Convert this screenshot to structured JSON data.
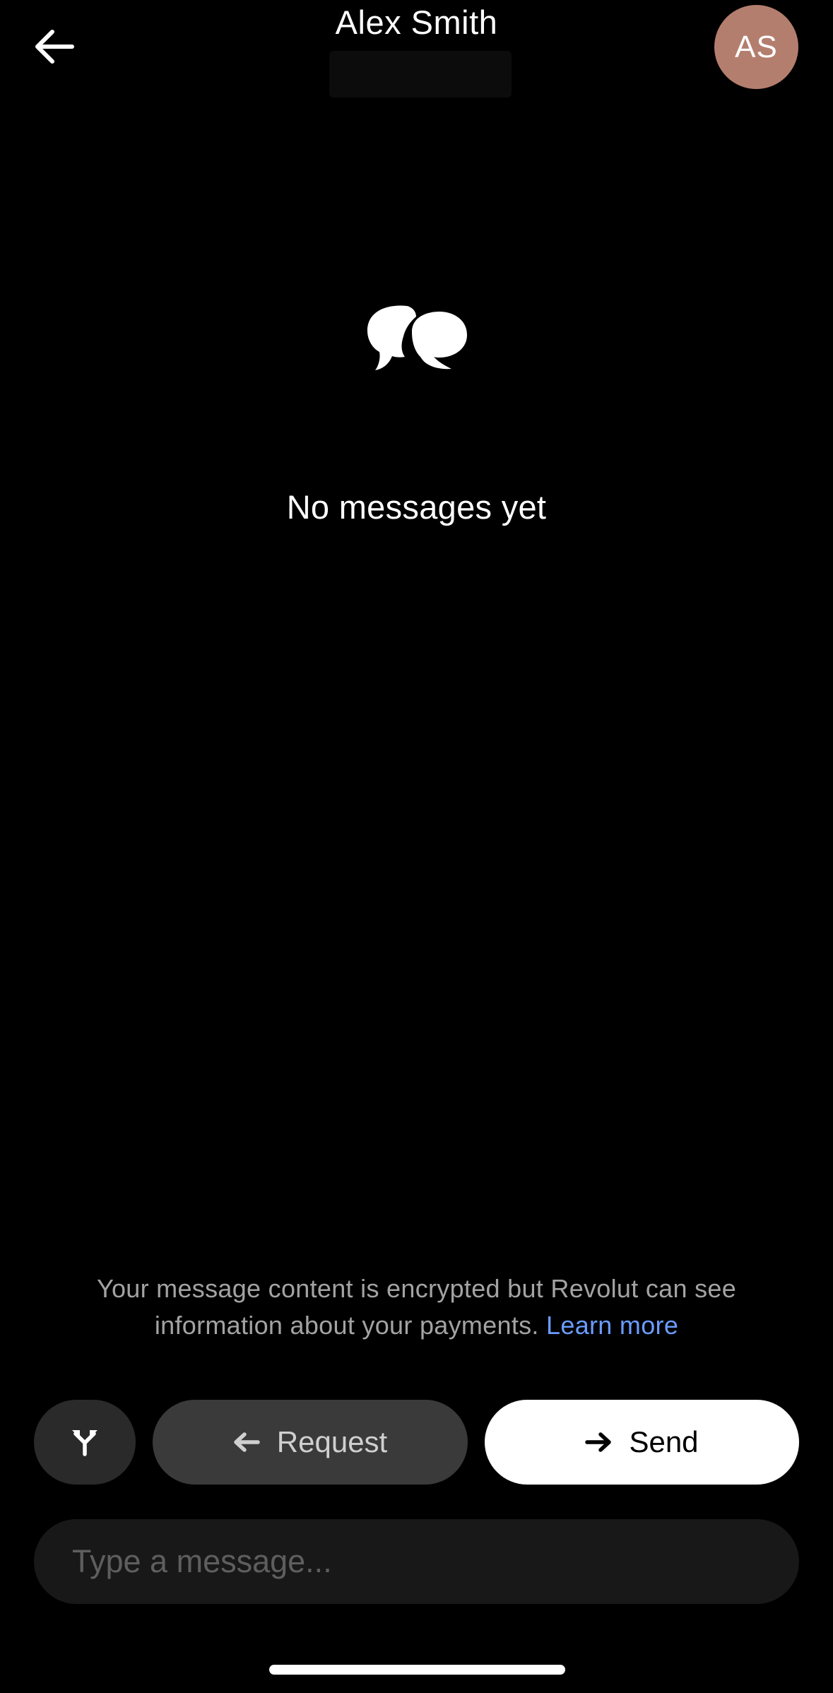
{
  "header": {
    "back_icon": "arrow-left-icon",
    "title": "Alex Smith",
    "avatar_initials": "AS",
    "avatar_color": "#b47e6e"
  },
  "empty_state": {
    "icon": "speech-bubbles-icon",
    "text": "No messages yet"
  },
  "notice": {
    "text": "Your message content is encrypted but Revolut can see information about your payments.",
    "link_label": "Learn more",
    "link_color": "#6b9cff"
  },
  "actions": {
    "split_icon": "split-icon",
    "request_label": "Request",
    "request_icon": "arrow-left-icon",
    "send_label": "Send",
    "send_icon": "arrow-right-icon"
  },
  "composer": {
    "placeholder": "Type a message...",
    "value": ""
  }
}
